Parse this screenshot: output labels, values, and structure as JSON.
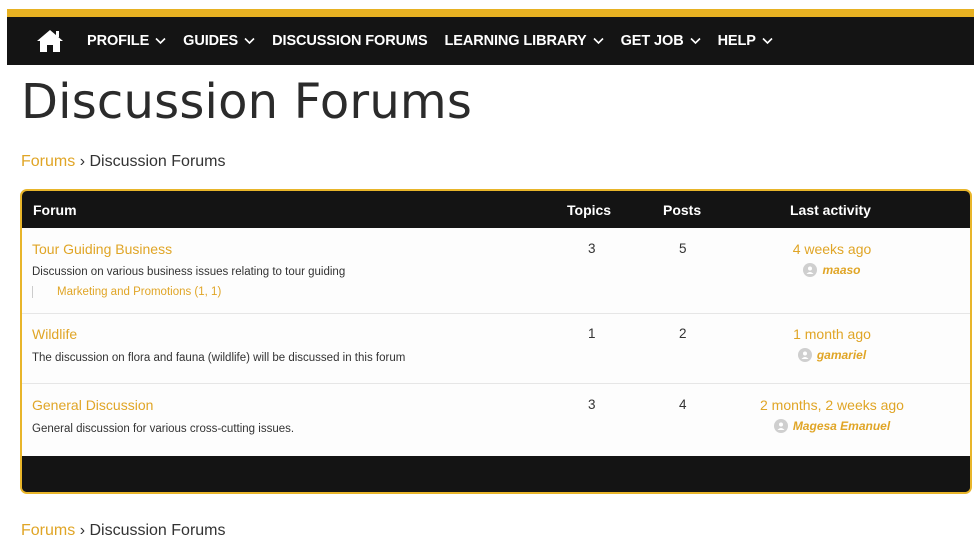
{
  "nav": {
    "home_icon": "home-icon",
    "items": [
      {
        "label": "PROFILE",
        "dropdown": true
      },
      {
        "label": "GUIDES",
        "dropdown": true
      },
      {
        "label": "DISCUSSION FORUMS",
        "dropdown": false
      },
      {
        "label": "LEARNING LIBRARY",
        "dropdown": true
      },
      {
        "label": "GET JOB",
        "dropdown": true
      },
      {
        "label": "HELP",
        "dropdown": true
      }
    ]
  },
  "page": {
    "title": "Discussion Forums"
  },
  "breadcrumb": {
    "root": "Forums",
    "separator": "›",
    "current": "Discussion Forums"
  },
  "table": {
    "headers": {
      "forum": "Forum",
      "topics": "Topics",
      "posts": "Posts",
      "last_activity": "Last activity"
    },
    "rows": [
      {
        "title": "Tour Guiding Business",
        "description": "Discussion on various business issues relating to tour guiding",
        "subforum": "Marketing and Promotions (1, 1)",
        "topics": "3",
        "posts": "5",
        "last_time": "4 weeks ago",
        "last_user": "maaso"
      },
      {
        "title": "Wildlife",
        "description": "The discussion on flora and fauna (wildlife) will be discussed in this forum",
        "topics": "1",
        "posts": "2",
        "last_time": "1 month ago",
        "last_user": "gamariel"
      },
      {
        "title": "General Discussion",
        "description": "General discussion for various cross-cutting issues.",
        "topics": "3",
        "posts": "4",
        "last_time": "2 months, 2 weeks ago",
        "last_user": "Magesa Emanuel"
      }
    ]
  },
  "colors": {
    "accent": "#e0a526",
    "gold_bar": "#e7b122",
    "nav_bg": "#141414"
  }
}
